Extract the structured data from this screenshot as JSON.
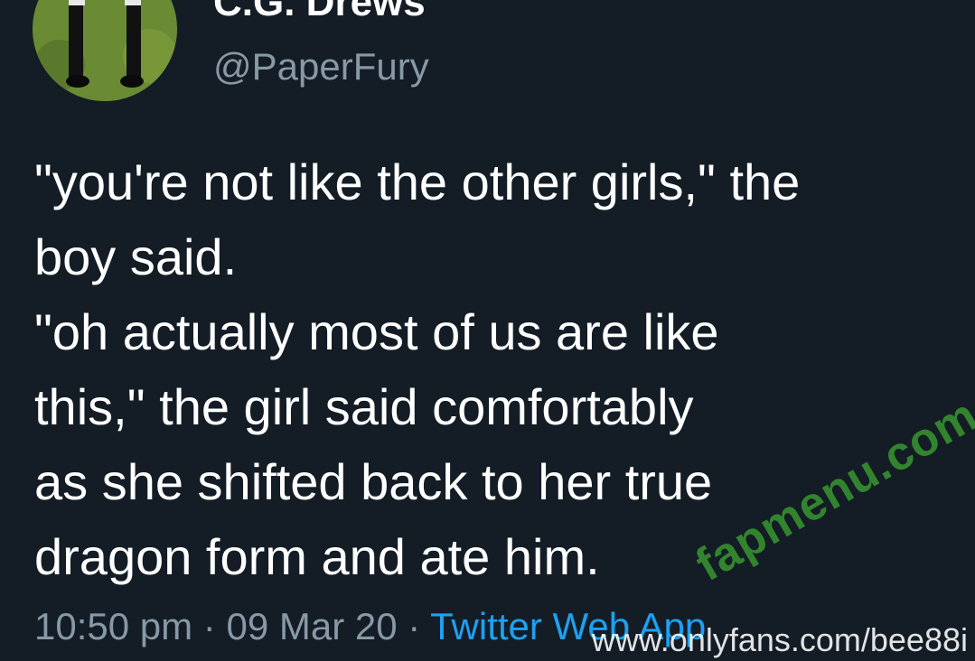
{
  "tweet": {
    "display_name": "C.G. Drews",
    "handle": "@PaperFury",
    "text_lines": [
      "\"you're not like the other girls,\" the",
      "boy said.",
      "\"oh actually most of us are like",
      "this,\" the girl said comfortably",
      "as she shifted back to her true",
      "dragon form and ate him."
    ],
    "time": "10:50 pm",
    "separator": "·",
    "date": "09 Mar 20",
    "source": "Twitter Web App"
  },
  "watermarks": {
    "brand": "fapmenu.com",
    "url": "www.onlyfans.com/bee88i"
  },
  "colors": {
    "background": "#141d26",
    "text": "#ffffff",
    "secondary": "#8899a6",
    "link": "#1da1f2",
    "watermark_green": "#389630"
  }
}
